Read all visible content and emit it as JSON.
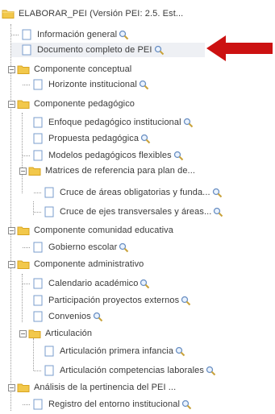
{
  "tree": {
    "root": {
      "label": "ELABORAR_PEI (Versión PEI: 2.5. Est..."
    },
    "items": [
      {
        "label": "Información general",
        "search": true
      },
      {
        "label": "Documento completo de PEI",
        "search": true,
        "selected": true
      },
      {
        "label": "Componente conceptual",
        "expanded": true
      },
      {
        "label": "Horizonte institucional",
        "search": true
      },
      {
        "label": "Componente pedagógico",
        "expanded": true
      },
      {
        "label": "Enfoque pedagógico institucional",
        "search": true
      },
      {
        "label": "Propuesta pedagógica",
        "search": true
      },
      {
        "label": "Modelos pedagógicos flexibles",
        "search": true
      },
      {
        "label": "Matrices de referencia para plan de...",
        "expanded": true
      },
      {
        "label": "Cruce de áreas obligatorias y funda...",
        "search": true
      },
      {
        "label": "Cruce de ejes transversales y áreas...",
        "search": true
      },
      {
        "label": "Componente comunidad educativa",
        "expanded": true
      },
      {
        "label": "Gobierno escolar",
        "search": true
      },
      {
        "label": "Componente administrativo",
        "expanded": true
      },
      {
        "label": "Calendario académico",
        "search": true
      },
      {
        "label": "Participación proyectos externos",
        "search": true
      },
      {
        "label": "Convenios",
        "search": true
      },
      {
        "label": "Articulación",
        "expanded": true
      },
      {
        "label": "Articulación primera infancia",
        "search": true
      },
      {
        "label": "Articulación competencias laborales",
        "search": true
      },
      {
        "label": "Análisis de la pertinencia del PEI ...",
        "expanded": true
      },
      {
        "label": "Registro del entorno institucional",
        "search": true
      }
    ]
  },
  "icons": {
    "folder": "folder-icon",
    "document": "document-icon",
    "search": "magnifier-icon",
    "collapse": "minus-toggle-icon",
    "pointer": "red-arrow-icon"
  },
  "colors": {
    "folder": "#f2c84b",
    "folder_dark": "#d9a520",
    "doc_border": "#7a9ccc",
    "arrow": "#cc1111",
    "highlight": "#eef0f4"
  }
}
